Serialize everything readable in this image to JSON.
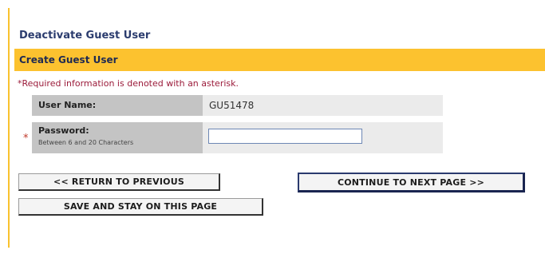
{
  "page": {
    "title": "Deactivate Guest User",
    "section_title": "Create Guest User",
    "required_note": "*Required information is denoted with an asterisk.",
    "accent_color": "#fcc22f",
    "required_color": "#9b1b3a"
  },
  "form": {
    "username_label": "User Name:",
    "username_value": "GU51478",
    "password_label": "Password:",
    "password_hint": "Between 6 and 20 Characters",
    "password_value": "",
    "required_marker": "*"
  },
  "buttons": {
    "return_label": "<< RETURN TO PREVIOUS",
    "continue_label": "CONTINUE TO NEXT PAGE >>",
    "save_label": "SAVE AND STAY ON THIS PAGE"
  }
}
